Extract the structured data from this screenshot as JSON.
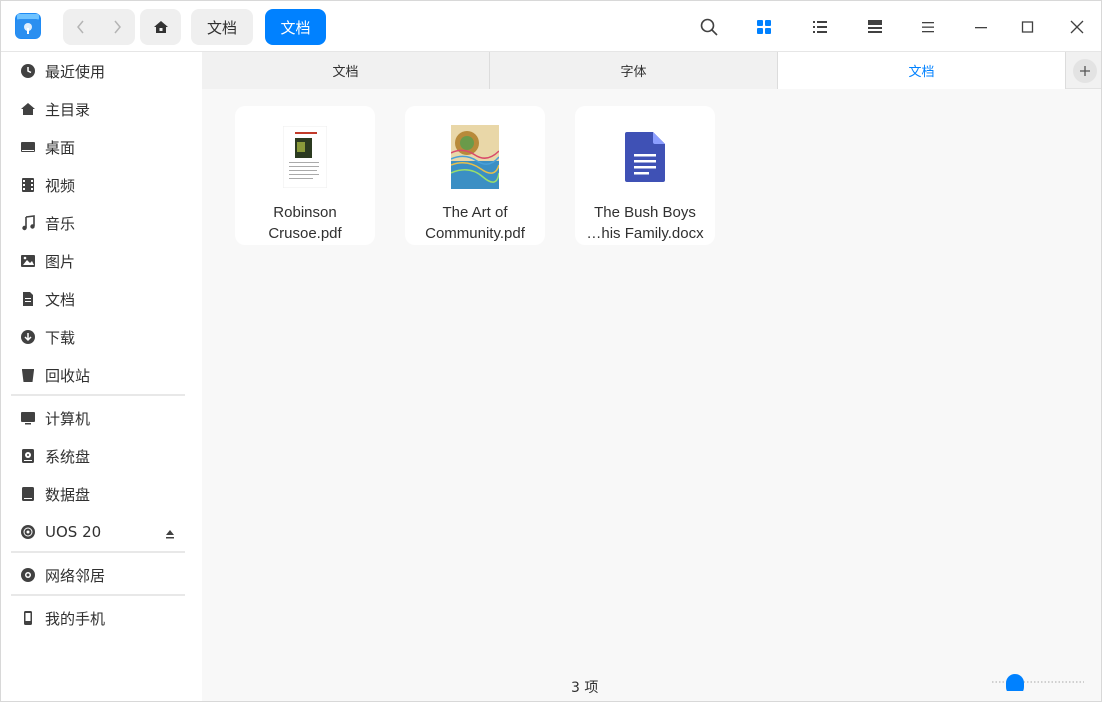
{
  "titlebar": {
    "breadcrumbs": [
      "文档",
      "文档"
    ],
    "view_icons": [
      "search-icon",
      "icon-view-icon",
      "list-view-icon",
      "detail-view-icon",
      "menu-icon",
      "minimize-icon",
      "maximize-icon",
      "close-icon"
    ],
    "accent": "#0081ff"
  },
  "sidebar": {
    "groups": [
      [
        {
          "label": "最近使用",
          "icon": "clock-icon"
        },
        {
          "label": "主目录",
          "icon": "home-icon"
        },
        {
          "label": "桌面",
          "icon": "desktop-icon"
        },
        {
          "label": "视频",
          "icon": "video-icon"
        },
        {
          "label": "音乐",
          "icon": "music-icon"
        },
        {
          "label": "图片",
          "icon": "picture-icon"
        },
        {
          "label": "文档",
          "icon": "document-icon"
        },
        {
          "label": "下载",
          "icon": "download-icon"
        },
        {
          "label": "回收站",
          "icon": "trash-icon"
        }
      ],
      [
        {
          "label": "计算机",
          "icon": "computer-icon"
        },
        {
          "label": "系统盘",
          "icon": "system-disk-icon"
        },
        {
          "label": "数据盘",
          "icon": "data-disk-icon"
        },
        {
          "label": "UOS 20",
          "icon": "optical-disc-icon"
        }
      ],
      [
        {
          "label": "网络邻居",
          "icon": "network-icon"
        }
      ],
      [
        {
          "label": "我的手机",
          "icon": "phone-icon"
        }
      ]
    ]
  },
  "tabs": [
    {
      "label": "文档",
      "active": false
    },
    {
      "label": "字体",
      "active": false
    },
    {
      "label": "文档",
      "active": true
    }
  ],
  "files": [
    {
      "name": "Robinson\nCrusoe.pdf",
      "type": "pdf-thumbnail"
    },
    {
      "name": "The Art of\nCommunity.pdf",
      "type": "pdf-cover"
    },
    {
      "name": "The Bush Boys\n…his Family.docx",
      "type": "docx"
    }
  ],
  "status": {
    "count_text": "3 项"
  }
}
